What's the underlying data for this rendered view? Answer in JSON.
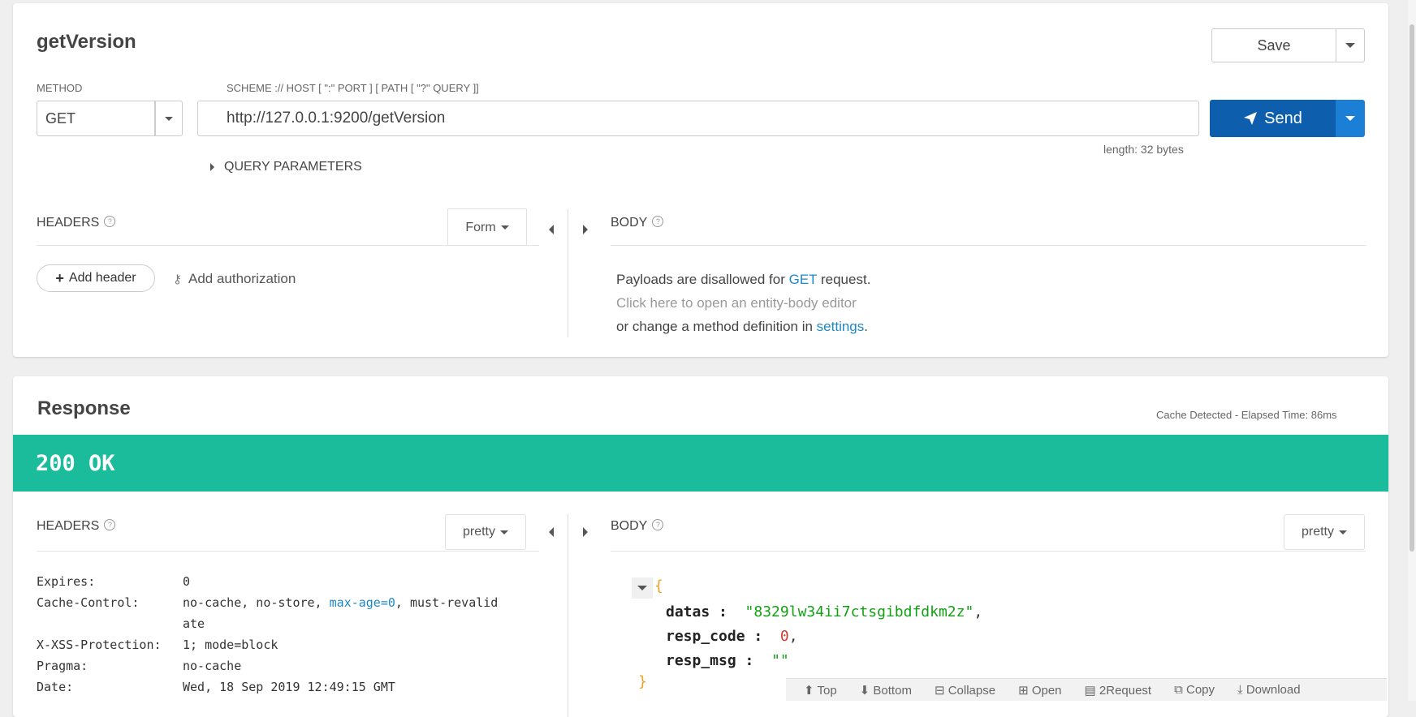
{
  "request": {
    "title": "getVersion",
    "save_label": "Save",
    "method_label": "METHOD",
    "method_value": "GET",
    "url_label": "SCHEME :// HOST [ \":\" PORT ] [ PATH [ \"?\" QUERY ]]",
    "url_value": "http://127.0.0.1:9200/getVersion",
    "send_label": "Send",
    "length_text": "length: 32 bytes",
    "query_params_label": "QUERY PARAMETERS",
    "headers_label": "HEADERS",
    "form_label": "Form",
    "add_header_label": "Add header",
    "add_auth_label": "Add authorization",
    "body_label": "BODY",
    "body_msg_prefix": "Payloads are disallowed for ",
    "body_msg_method": "GET",
    "body_msg_suffix": " request.",
    "body_msg_editor": "Click here to open an entity-body editor",
    "body_msg_change": "or change a method definition in ",
    "body_msg_settings": "settings",
    "body_msg_dot": "."
  },
  "response": {
    "title": "Response",
    "cache_text": "Cache Detected - Elapsed Time: 86ms",
    "status_text": "200 OK",
    "headers_label": "HEADERS",
    "headers_mode": "pretty",
    "body_label": "BODY",
    "body_mode": "pretty",
    "headers": [
      {
        "name": "Expires:",
        "value": "0"
      },
      {
        "name": "Cache-Control:",
        "value_a": "no-cache, no-store, ",
        "value_link": "max-age=0",
        "value_b": ", must-revalid",
        "value_cont": "ate"
      },
      {
        "name": "X-XSS-Protection:",
        "value": "1; mode=block"
      },
      {
        "name": "Pragma:",
        "value": "no-cache"
      },
      {
        "name": "Date:",
        "value": "Wed, 18 Sep 2019 12:49:15 GMT"
      }
    ],
    "json": {
      "open_brace": "{",
      "close_brace": "}",
      "rows": [
        {
          "key": "datas",
          "sep": " : ",
          "value": "\"8329lw34ii7ctsgibdfdkm2z\"",
          "comma": ","
        },
        {
          "key": "resp_code",
          "sep": " : ",
          "value": "0",
          "comma": ","
        },
        {
          "key": "resp_msg",
          "sep": " : ",
          "value": "\"\"",
          "comma": ""
        }
      ]
    },
    "toolbar": {
      "top": "Top",
      "bottom": "Bottom",
      "collapse": "Collapse",
      "open": "Open",
      "to_request": "2Request",
      "copy": "Copy",
      "download": "Download"
    }
  },
  "colors": {
    "status_bg": "#1abc9c",
    "send_bg": "#0d5fad",
    "send_dropdown_bg": "#1c7fd6",
    "link": "#1e88c7",
    "json_string": "#12a012",
    "json_number": "#d13b2f",
    "json_brace": "#f0a020"
  }
}
